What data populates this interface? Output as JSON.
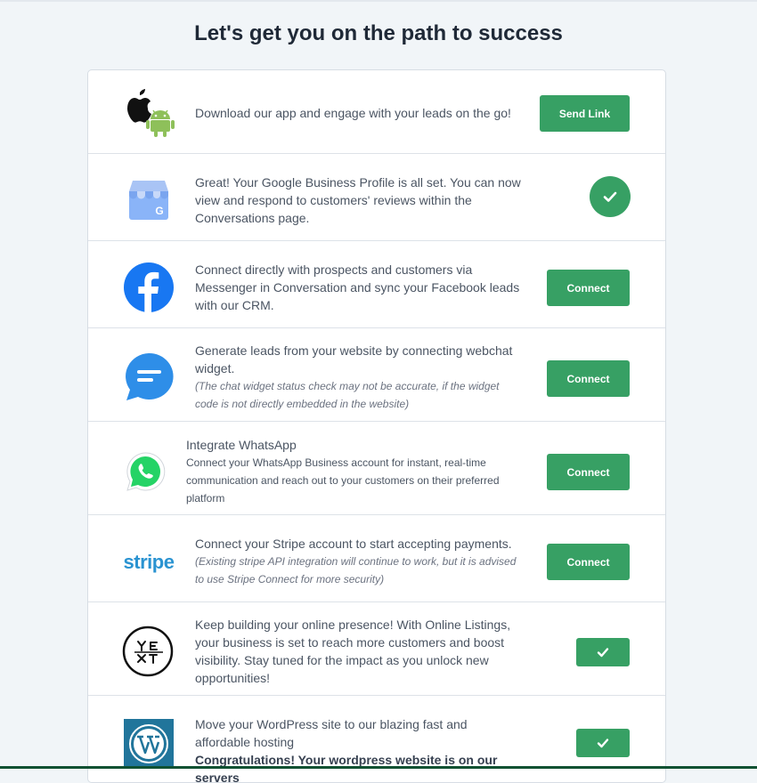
{
  "page": {
    "title": "Let's get you on the path to success"
  },
  "rows": {
    "app": {
      "text": "Download our app and engage with your leads on the go!",
      "button": "Send Link",
      "icons": [
        "apple-icon",
        "android-icon"
      ]
    },
    "google": {
      "text": "Great! Your Google Business Profile is all set. You can now view and respond to customers' reviews within the Conversations page.",
      "status": "connected",
      "icon": "google-business-icon"
    },
    "facebook": {
      "text": "Connect directly with prospects and customers via Messenger in Conversation and sync your Facebook leads with our CRM.",
      "button": "Connect",
      "icon": "facebook-icon"
    },
    "webchat": {
      "text": "Generate leads from your website by connecting webchat widget.",
      "note": "(The chat widget status check may not be accurate, if the widget code is not directly embedded in the website)",
      "button": "Connect",
      "icon": "chat-bubble-icon"
    },
    "whatsapp": {
      "title": "Integrate WhatsApp",
      "text": "Connect your WhatsApp Business account for instant, real-time communication and reach out to your customers on their preferred platform",
      "button": "Connect",
      "icon": "whatsapp-icon"
    },
    "stripe": {
      "logo_text": "stripe",
      "text": "Connect your Stripe account to start accepting payments.",
      "note": "(Existing stripe API integration will continue to work, but it is advised to use Stripe Connect for more security)",
      "button": "Connect"
    },
    "yext": {
      "text": "Keep building your online presence! With Online Listings, your business is set to reach more customers and boost visibility. Stay tuned for the impact as you unlock new opportunities!",
      "status": "connected",
      "icon": "yext-logo"
    },
    "wordpress": {
      "text": "Move your WordPress site to our blazing fast and affordable hosting",
      "bold_text": "Congratulations! Your wordpress website is on our servers",
      "status": "connected",
      "icon": "wordpress-icon"
    }
  },
  "colors": {
    "accent": "#37a064",
    "background": "#f1f5f8",
    "facebook": "#1877f2",
    "stripe": "#2a93d1",
    "whatsapp": "#25d366",
    "wordpress": "#21759b"
  }
}
